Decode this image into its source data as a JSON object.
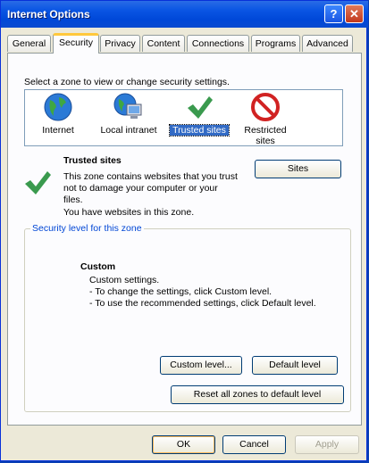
{
  "window": {
    "title": "Internet Options"
  },
  "title_buttons": {
    "help": "?",
    "close": "✕"
  },
  "tabs": [
    {
      "label": "General"
    },
    {
      "label": "Security",
      "active": true
    },
    {
      "label": "Privacy"
    },
    {
      "label": "Content"
    },
    {
      "label": "Connections"
    },
    {
      "label": "Programs"
    },
    {
      "label": "Advanced"
    }
  ],
  "zone_prompt": "Select a zone to view or change security settings.",
  "zones": [
    {
      "label": "Internet",
      "icon": "globe-icon"
    },
    {
      "label": "Local intranet",
      "icon": "intranet-icon"
    },
    {
      "label": "Trusted sites",
      "icon": "checkmark-icon",
      "selected": true
    },
    {
      "label": "Restricted sites",
      "icon": "restricted-icon"
    }
  ],
  "selected_zone": {
    "title": "Trusted sites",
    "desc": "This zone contains websites that you trust not to damage your computer or your files.",
    "note": "You have websites in this zone.",
    "sites_button": "Sites"
  },
  "security_level": {
    "legend": "Security level for this zone",
    "title": "Custom",
    "lines": [
      "Custom settings.",
      "- To change the settings, click Custom level.",
      "- To use the recommended settings, click Default level."
    ],
    "custom_button": "Custom level...",
    "default_button": "Default level"
  },
  "reset_button": "Reset all zones to default level",
  "footer": {
    "ok": "OK",
    "cancel": "Cancel",
    "apply": "Apply"
  },
  "colors": {
    "titlebar": "#0054e3",
    "selection": "#316ac5",
    "legend": "#0046d5"
  }
}
